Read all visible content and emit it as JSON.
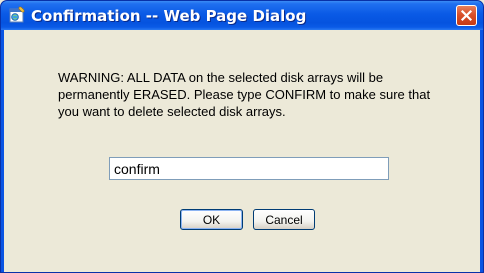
{
  "window": {
    "title": "Confirmation -- Web Page Dialog",
    "title_icon": "page-dialog-icon",
    "close_icon": "close-icon"
  },
  "dialog": {
    "message": "WARNING: ALL DATA on the selected disk arrays will be permanently ERASED. Please type CONFIRM to make sure that you want to delete selected disk arrays.",
    "input_value": "confirm",
    "ok_label": "OK",
    "cancel_label": "Cancel"
  },
  "colors": {
    "titlebar": "#0a5ae6",
    "client_background": "#ece9d8",
    "close_button": "#d9502b"
  }
}
